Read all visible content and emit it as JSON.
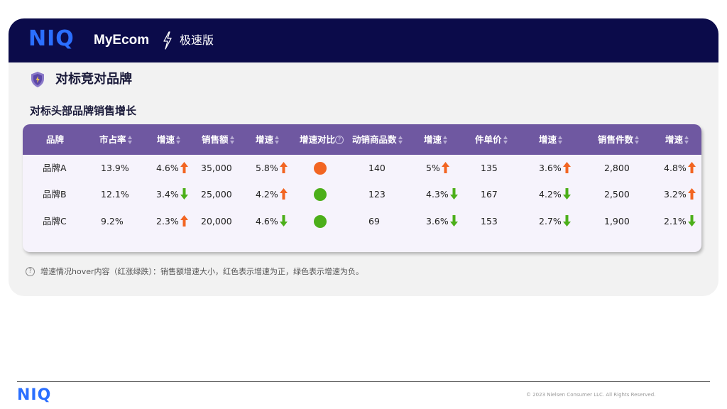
{
  "header": {
    "logo": "NIQ",
    "app_name": "MyEcom",
    "mode_label": "极速版"
  },
  "section": {
    "title": "对标竞对品牌",
    "subtitle": "对标头部品牌销售增长"
  },
  "colors": {
    "header_bg": "#0b0b4a",
    "brand_blue": "#2b6fff",
    "table_header_bg": "#6f58a1",
    "table_body_bg": "#f6f3fc",
    "up_red": "#f26522",
    "down_green": "#4caf1a"
  },
  "table": {
    "columns": [
      {
        "label": "品牌",
        "sortable": false
      },
      {
        "label": "市占率",
        "sortable": true
      },
      {
        "label": "增速",
        "sortable": true
      },
      {
        "label": "销售额",
        "sortable": true
      },
      {
        "label": "增速",
        "sortable": true
      },
      {
        "label": "增速对比",
        "sortable": false,
        "help": true
      },
      {
        "label": "动销商品数",
        "sortable": true
      },
      {
        "label": "增速",
        "sortable": true
      },
      {
        "label": "件单价",
        "sortable": true
      },
      {
        "label": "增速",
        "sortable": true
      },
      {
        "label": "销售件数",
        "sortable": true
      },
      {
        "label": "增速",
        "sortable": true
      }
    ],
    "rows": [
      {
        "brand": "品牌A",
        "share": "13.9%",
        "share_growth": "4.6%",
        "share_dir": "up",
        "sales": "35,000",
        "sales_growth": "5.8%",
        "sales_dir": "up",
        "compare": "up",
        "sku": "140",
        "sku_growth": "5%",
        "sku_dir": "up",
        "price": "135",
        "price_growth": "3.6%",
        "price_dir": "up",
        "units": "2,800",
        "units_growth": "4.8%",
        "units_dir": "up"
      },
      {
        "brand": "品牌B",
        "share": "12.1%",
        "share_growth": "3.4%",
        "share_dir": "down",
        "sales": "25,000",
        "sales_growth": "4.2%",
        "sales_dir": "up",
        "compare": "down",
        "sku": "123",
        "sku_growth": "4.3%",
        "sku_dir": "down",
        "price": "167",
        "price_growth": "4.2%",
        "price_dir": "down",
        "units": "2,500",
        "units_growth": "3.2%",
        "units_dir": "up"
      },
      {
        "brand": "品牌C",
        "share": "9.2%",
        "share_growth": "2.3%",
        "share_dir": "up",
        "sales": "20,000",
        "sales_growth": "4.6%",
        "sales_dir": "down",
        "compare": "down",
        "sku": "69",
        "sku_growth": "3.6%",
        "sku_dir": "down",
        "price": "153",
        "price_growth": "2.7%",
        "price_dir": "down",
        "units": "1,900",
        "units_growth": "2.1%",
        "units_dir": "down"
      }
    ]
  },
  "note": "增速情况hover内容（红涨绿跌）：销售额增速大小，红色表示增速为正，绿色表示增速为负。",
  "footer": {
    "logo": "NIQ",
    "copyright": "© 2023 Nielsen Consumer LLC. All Rights Reserved."
  }
}
